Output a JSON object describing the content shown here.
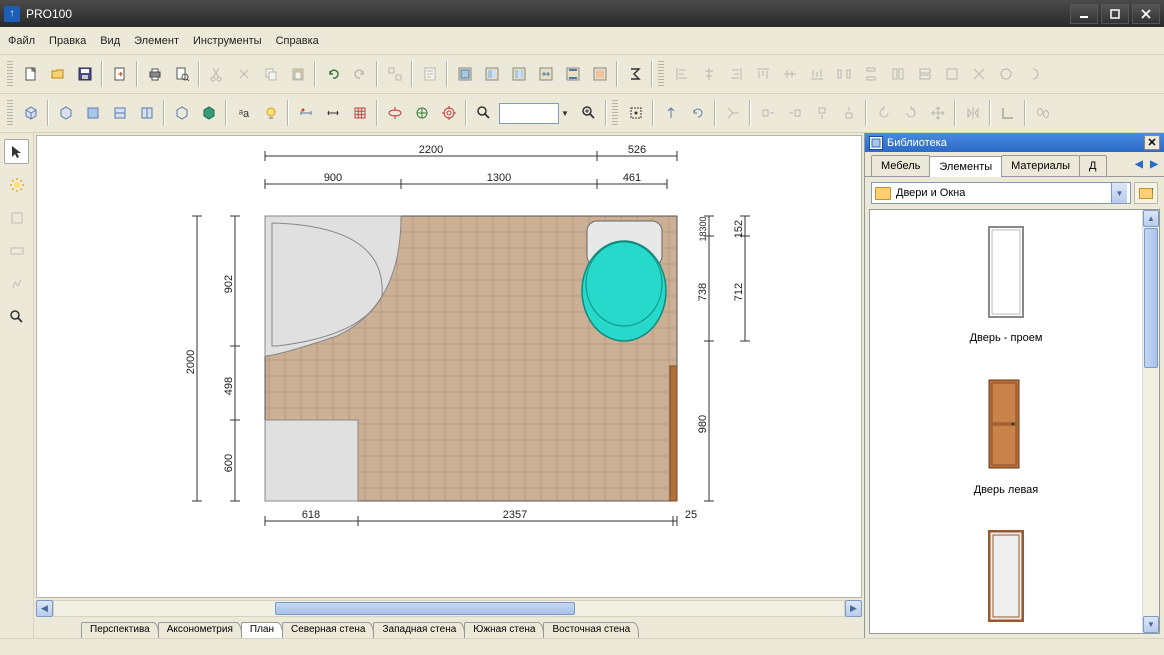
{
  "app": {
    "title": "PRO100"
  },
  "menu": {
    "items": [
      "Файл",
      "Правка",
      "Вид",
      "Элемент",
      "Инструменты",
      "Справка"
    ]
  },
  "bottom_tabs": [
    "Перспектива",
    "Аксонометрия",
    "План",
    "Северная стена",
    "Западная стена",
    "Южная стена",
    "Восточная стена"
  ],
  "bottom_active_index": 2,
  "library": {
    "title": "Библиотека",
    "tabs": [
      "Мебель",
      "Элементы",
      "Материалы",
      "Д"
    ],
    "active_tab_index": 1,
    "path": "Двери и Окна",
    "items": [
      {
        "label": "Дверь - проем"
      },
      {
        "label": "Дверь левая"
      },
      {
        "label": ""
      }
    ]
  },
  "dimensions": {
    "top_outer": {
      "left": "2200",
      "right": "526"
    },
    "top_inner": {
      "a": "900",
      "b": "1300",
      "c": "461"
    },
    "left_outer": "2000",
    "left_inner": {
      "a": "902",
      "b": "498",
      "c": "600"
    },
    "right_outer": "712",
    "right_inner": {
      "top": "152",
      "a": "738",
      "b": "980"
    },
    "right_label_rotated": "18300",
    "bottom": {
      "a": "618",
      "b": "2357",
      "c": "25"
    }
  }
}
